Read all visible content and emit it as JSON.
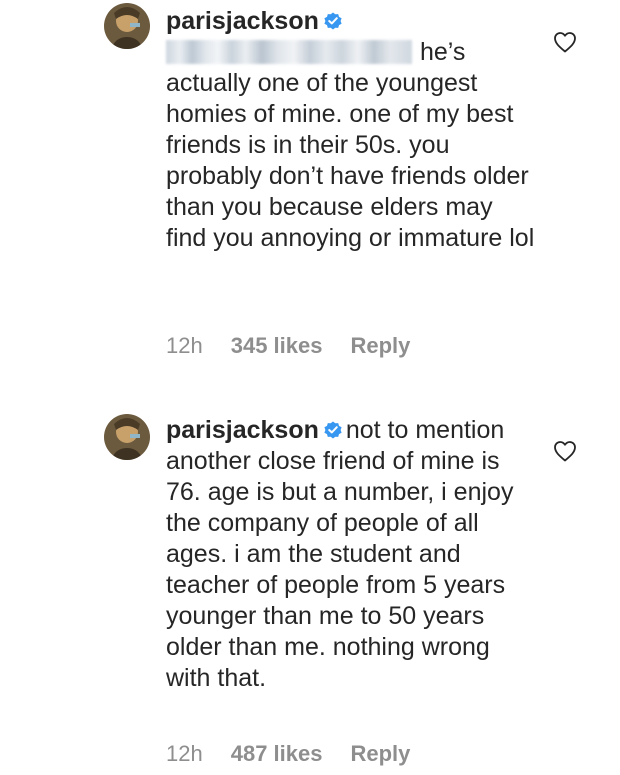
{
  "comments": [
    {
      "username": "parisjackson",
      "mention_hidden": true,
      "text": "he’s actually one of the youngest homies of mine. one of my best friends is in their 50s. you probably don’t have friends older than you because elders may find you annoying or immature lol",
      "time": "12h",
      "likes": "345 likes",
      "reply": "Reply",
      "icons": {
        "avatar": "avatar-photo",
        "verified": "verified-badge-icon",
        "like": "heart-outline-icon"
      }
    },
    {
      "username": "parisjackson",
      "mention_hidden": false,
      "text": "not to mention another close friend of mine is 76. age is but a number, i enjoy the company of people of all ages. i am the student and teacher of people from 5 years younger than me to 50 years older than me. nothing wrong with that.",
      "time": "12h",
      "likes": "487 likes",
      "reply": "Reply",
      "icons": {
        "avatar": "avatar-photo",
        "verified": "verified-badge-icon",
        "like": "heart-outline-icon"
      }
    }
  ],
  "colors": {
    "text": "#262626",
    "meta": "#8e8e8e",
    "verified": "#3897f0"
  }
}
